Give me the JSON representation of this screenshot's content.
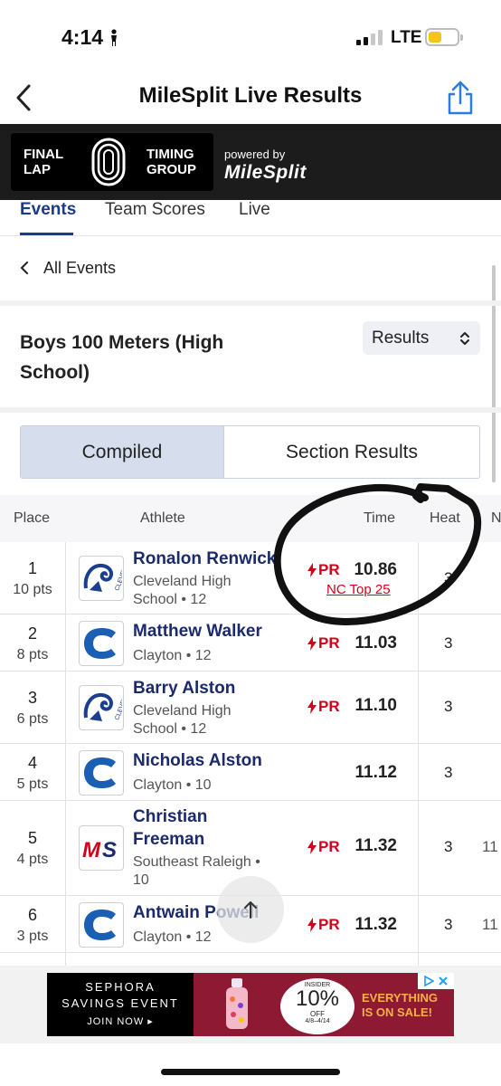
{
  "status_bar": {
    "time": "4:14",
    "network": "LTE"
  },
  "nav": {
    "title": "MileSplit Live Results"
  },
  "banner": {
    "logo_line1_left": "FINAL",
    "logo_line2_left": "LAP",
    "logo_line1_right": "TIMING",
    "logo_line2_right": "GROUP",
    "powered_by": "powered by",
    "brand": "MileSplit"
  },
  "tabs": [
    {
      "label": "Events"
    },
    {
      "label": "Team Scores"
    },
    {
      "label": "Live"
    }
  ],
  "back_link": "All Events",
  "event": {
    "title": "Boys 100 Meters (High School)",
    "view_select": "Results"
  },
  "segmented": {
    "compiled": "Compiled",
    "section": "Section Results"
  },
  "table": {
    "headers": {
      "place": "Place",
      "athlete": "Athlete",
      "time": "Time",
      "heat": "Heat",
      "extra": "N"
    },
    "rows": [
      {
        "place": "1",
        "pts": "10 pts",
        "name": "Ronalon Renwick",
        "school": "Cleveland High School • 12",
        "pr": "PR",
        "time": "10.86",
        "rank": "NC Top 25",
        "heat": "3",
        "extra": ""
      },
      {
        "place": "2",
        "pts": "8 pts",
        "name": "Matthew Walker",
        "school": "Clayton • 12",
        "pr": "PR",
        "time": "11.03",
        "rank": "",
        "heat": "3",
        "extra": ""
      },
      {
        "place": "3",
        "pts": "6 pts",
        "name": "Barry Alston",
        "school": "Cleveland High School • 12",
        "pr": "PR",
        "time": "11.10",
        "rank": "",
        "heat": "3",
        "extra": ""
      },
      {
        "place": "4",
        "pts": "5 pts",
        "name": "Nicholas Alston",
        "school": "Clayton • 10",
        "pr": "",
        "time": "11.12",
        "rank": "",
        "heat": "3",
        "extra": ""
      },
      {
        "place": "5",
        "pts": "4 pts",
        "name": "Christian Freeman",
        "school": "Southeast Raleigh • 10",
        "pr": "PR",
        "time": "11.32",
        "rank": "",
        "heat": "3",
        "extra": "11"
      },
      {
        "place": "6",
        "pts": "3 pts",
        "name": "Antwain Powell",
        "school": "Clayton • 12",
        "pr": "PR",
        "time": "11.32",
        "rank": "",
        "heat": "3",
        "extra": "11"
      }
    ]
  },
  "ad": {
    "line1": "SEPHORA",
    "line2": "SAVINGS EVENT",
    "cta": "JOIN NOW ▸",
    "insider": "INSIDER",
    "discount": "10%",
    "off": "OFF",
    "dates": "4/8–4/14",
    "promo1": "EVERYTHING",
    "promo2": "IS ON SALE!"
  },
  "colors": {
    "brand_navy": "#1b2a6b",
    "accent_red": "#d0021b",
    "segment_active": "#d6deee"
  }
}
